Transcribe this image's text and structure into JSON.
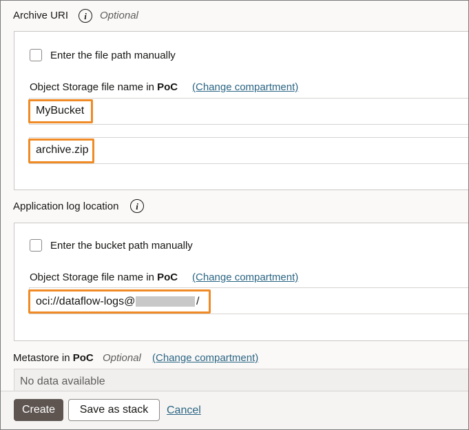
{
  "archive_uri": {
    "label": "Archive URI",
    "optional": "Optional",
    "manual_checkbox_label": "Enter the file path manually",
    "storage_label_prefix": "Object Storage file name in",
    "compartment": "PoC",
    "change_compartment": "(Change compartment)",
    "bucket_value": "MyBucket",
    "file_value": "archive.zip"
  },
  "app_log": {
    "label": "Application log location",
    "manual_checkbox_label": "Enter the bucket path manually",
    "storage_label_prefix": "Object Storage file name in",
    "compartment": "PoC",
    "change_compartment": "(Change compartment)",
    "path_prefix": "oci://dataflow-logs@",
    "path_suffix": "/"
  },
  "metastore": {
    "label_prefix": "Metastore in",
    "compartment": "PoC",
    "optional": "Optional",
    "change_compartment": "(Change compartment)",
    "empty_text": "No data available"
  },
  "footer": {
    "create_label": "Create",
    "save_stack_label": "Save as stack",
    "cancel_label": "Cancel"
  },
  "colors": {
    "highlight": "#f08a24",
    "link": "#2b6583",
    "primary_button": "#5e5551"
  },
  "icons": {
    "info": "info-icon"
  }
}
